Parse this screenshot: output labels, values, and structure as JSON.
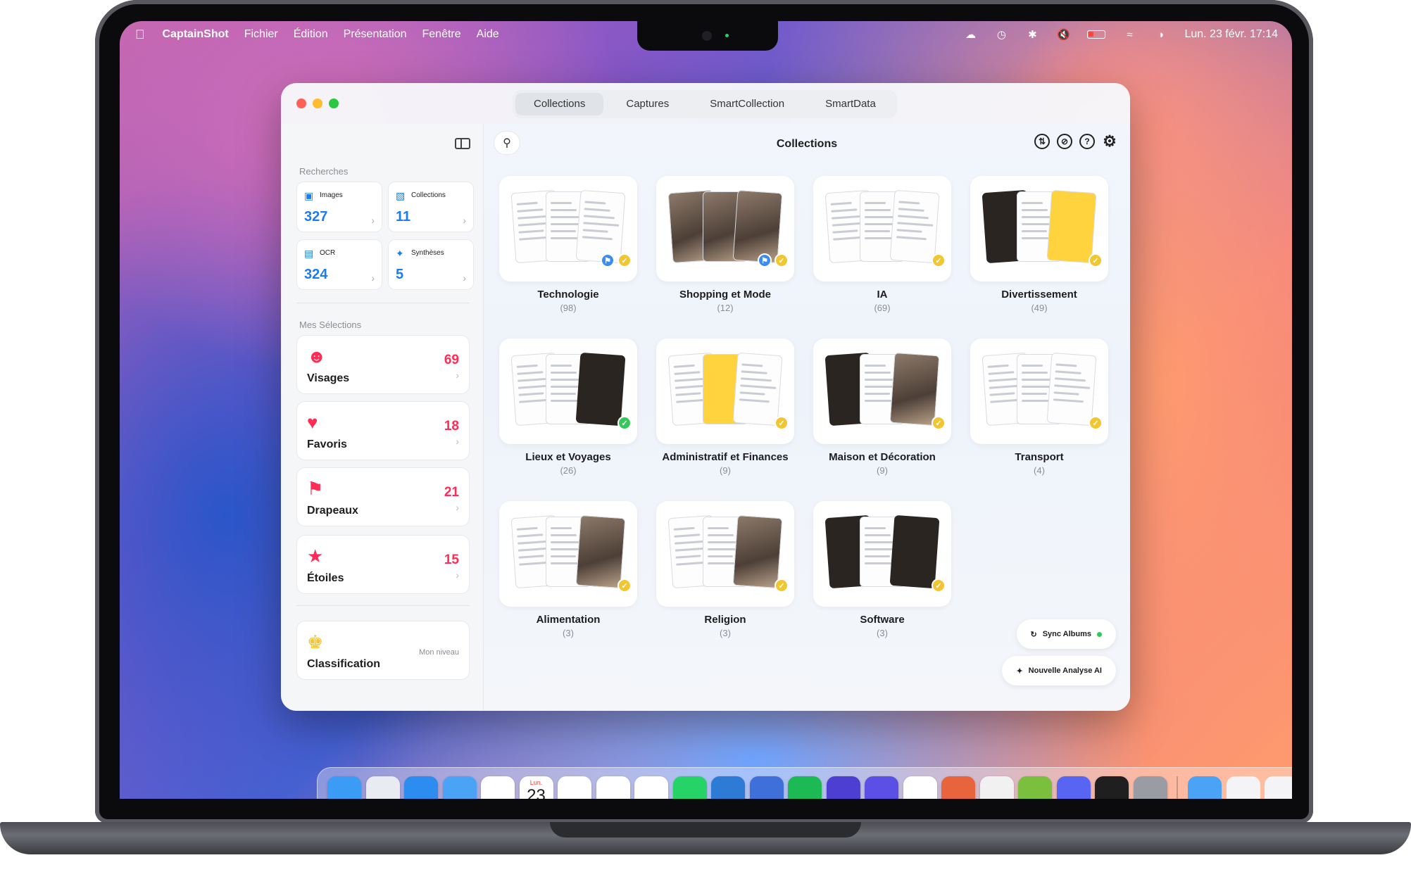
{
  "menubar": {
    "app_name": "CaptainShot",
    "menus": [
      "Fichier",
      "Édition",
      "Présentation",
      "Fenêtre",
      "Aide"
    ],
    "datetime": "Lun. 23 févr.  17:14"
  },
  "window": {
    "tabs": [
      "Collections",
      "Captures",
      "SmartCollection",
      "SmartData"
    ],
    "active_tab": "Collections",
    "title": "Collections"
  },
  "sidebar": {
    "searches_label": "Recherches",
    "search_tiles": [
      {
        "label": "Images",
        "count": "327",
        "icon": "image-icon"
      },
      {
        "label": "Collections",
        "count": "11",
        "icon": "folder-icon"
      },
      {
        "label": "OCR",
        "count": "324",
        "icon": "document-icon"
      },
      {
        "label": "Synthèses",
        "count": "5",
        "icon": "sparkles-icon"
      }
    ],
    "selections_label": "Mes Sélections",
    "selections": [
      {
        "label": "Visages",
        "count": "69",
        "icon": "face-icon"
      },
      {
        "label": "Favoris",
        "count": "18",
        "icon": "heart-icon"
      },
      {
        "label": "Drapeaux",
        "count": "21",
        "icon": "flag-icon"
      },
      {
        "label": "Étoiles",
        "count": "15",
        "icon": "star-icon"
      }
    ],
    "classification": {
      "label": "Classification",
      "level": "Mon niveau",
      "icon": "trophy-icon"
    }
  },
  "collections": [
    {
      "name": "Technologie",
      "count": "(98)",
      "pinned": true,
      "status": "yellow"
    },
    {
      "name": "Shopping et Mode",
      "count": "(12)",
      "pinned": true,
      "status": "yellow"
    },
    {
      "name": "IA",
      "count": "(69)",
      "pinned": false,
      "status": "yellow"
    },
    {
      "name": "Divertissement",
      "count": "(49)",
      "pinned": false,
      "status": "yellow"
    },
    {
      "name": "Lieux et Voyages",
      "count": "(26)",
      "pinned": false,
      "status": "green"
    },
    {
      "name": "Administratif et Finances",
      "count": "(9)",
      "pinned": false,
      "status": "yellow"
    },
    {
      "name": "Maison et Décoration",
      "count": "(9)",
      "pinned": false,
      "status": "yellow"
    },
    {
      "name": "Transport",
      "count": "(4)",
      "pinned": false,
      "status": "yellow"
    },
    {
      "name": "Alimentation",
      "count": "(3)",
      "pinned": false,
      "status": "yellow"
    },
    {
      "name": "Religion",
      "count": "(3)",
      "pinned": false,
      "status": "yellow"
    },
    {
      "name": "Software",
      "count": "(3)",
      "pinned": false,
      "status": "yellow"
    }
  ],
  "actions": {
    "sync": "Sync Albums",
    "analyse": "Nouvelle Analyse AI"
  },
  "dock": {
    "calendar_day": "Lun.",
    "calendar_date": "23",
    "apps": [
      "finder-icon",
      "launchpad-icon",
      "safari-icon",
      "mail-icon",
      "photos-icon",
      "calendar-icon",
      "reminders-icon",
      "notes-icon",
      "notion-icon",
      "whatsapp-icon",
      "xcode-icon",
      "terminal-icon",
      "spotify-icon",
      "captainshot-icon",
      "linear-icon",
      "chatgpt-icon",
      "claude-icon",
      "pixelmator-icon",
      "pencil-icon",
      "discord-icon",
      "passwords-icon",
      "settings-icon"
    ]
  },
  "colors": {
    "accent_blue": "#1a7cf2",
    "accent_pink": "#ff2d55",
    "status_yellow": "#f2c630",
    "status_green": "#34c759"
  }
}
